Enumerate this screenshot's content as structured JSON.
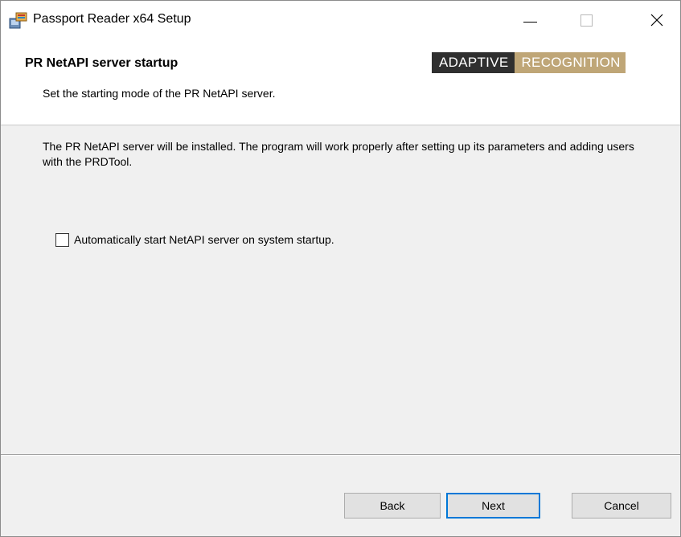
{
  "window": {
    "title": "Passport Reader x64 Setup",
    "icon": "installer-icon"
  },
  "header": {
    "title": "PR NetAPI server startup",
    "subtitle": "Set the starting mode of the PR NetAPI server.",
    "brand": {
      "part1": "ADAPTIVE",
      "part2": "RECOGNITION",
      "color_dark": "#2f2f2f",
      "color_gold": "#bfa677"
    }
  },
  "body": {
    "description": "The PR NetAPI server will be installed. The program will work properly after setting up its parameters and adding users with the PRDTool.",
    "autostart_checkbox": {
      "label": "Automatically start NetAPI server on system startup.",
      "checked": false
    }
  },
  "footer": {
    "back_label": "Back",
    "next_label": "Next",
    "cancel_label": "Cancel",
    "focus_color": "#0078d7"
  }
}
